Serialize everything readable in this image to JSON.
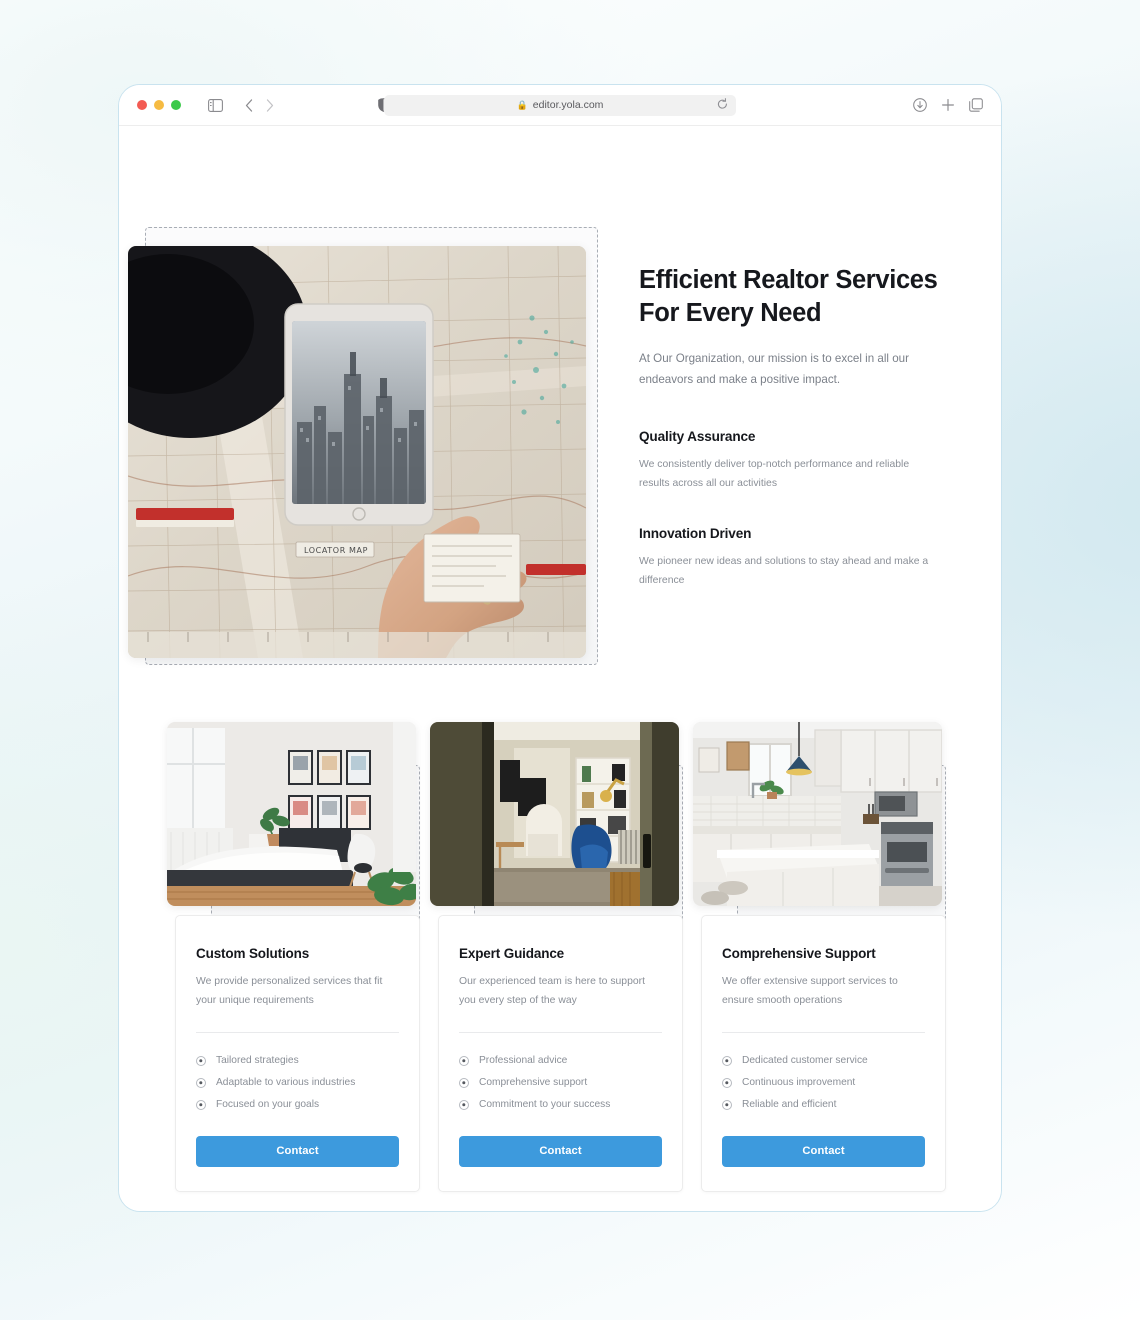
{
  "browser": {
    "url": "editor.yola.com",
    "lock_icon": "lock-icon",
    "traffic_lights": [
      "close-red",
      "minimize-yellow",
      "maximize-green"
    ],
    "left_icons": [
      "sidebar-toggle-icon",
      "back-chevron-icon",
      "forward-chevron-icon",
      "reader-shield-icon"
    ],
    "right_icons": [
      "download-icon",
      "new-tab-plus-icon",
      "tab-overview-icon"
    ],
    "reload_icon": "reload-icon"
  },
  "hero": {
    "title": "Efficient Realtor Services For Every Need",
    "subtitle": "At Our Organization, our mission is to excel in all our endeavors and make a positive impact.",
    "image_alt": "hand pointing at tablet showing city skyline on top of a paper road map",
    "features": [
      {
        "title": "Quality Assurance",
        "body": "We consistently deliver top-notch performance and reliable results across all our activities"
      },
      {
        "title": "Innovation Driven",
        "body": "We pioneer new ideas and solutions to stay ahead and make a difference"
      }
    ]
  },
  "cards": [
    {
      "image_alt": "bright bedroom with framed pictures above bed",
      "title": "Custom Solutions",
      "description": "We provide personalized services that fit your unique requirements",
      "bullets": [
        "Tailored strategies",
        "Adaptable to various industries",
        "Focused on your goals"
      ],
      "button_label": "Contact"
    },
    {
      "image_alt": "living room with blue velvet armchair and bookshelf",
      "title": "Expert Guidance",
      "description": "Our experienced team is here to support you every step of the way",
      "bullets": [
        "Professional advice",
        "Comprehensive support",
        "Commitment to your success"
      ],
      "button_label": "Contact"
    },
    {
      "image_alt": "modern white kitchen with island and pendant lamp",
      "title": "Comprehensive Support",
      "description": "We offer extensive support services to ensure smooth operations",
      "bullets": [
        "Dedicated customer service",
        "Continuous improvement",
        "Reliable and efficient"
      ],
      "button_label": "Contact"
    }
  ],
  "colors": {
    "accent_blue": "#3d9add",
    "heading": "#16181d",
    "body_text": "#8a8f97",
    "selection_dash": "#a8adb5",
    "browser_border": "#c9e3ef"
  }
}
